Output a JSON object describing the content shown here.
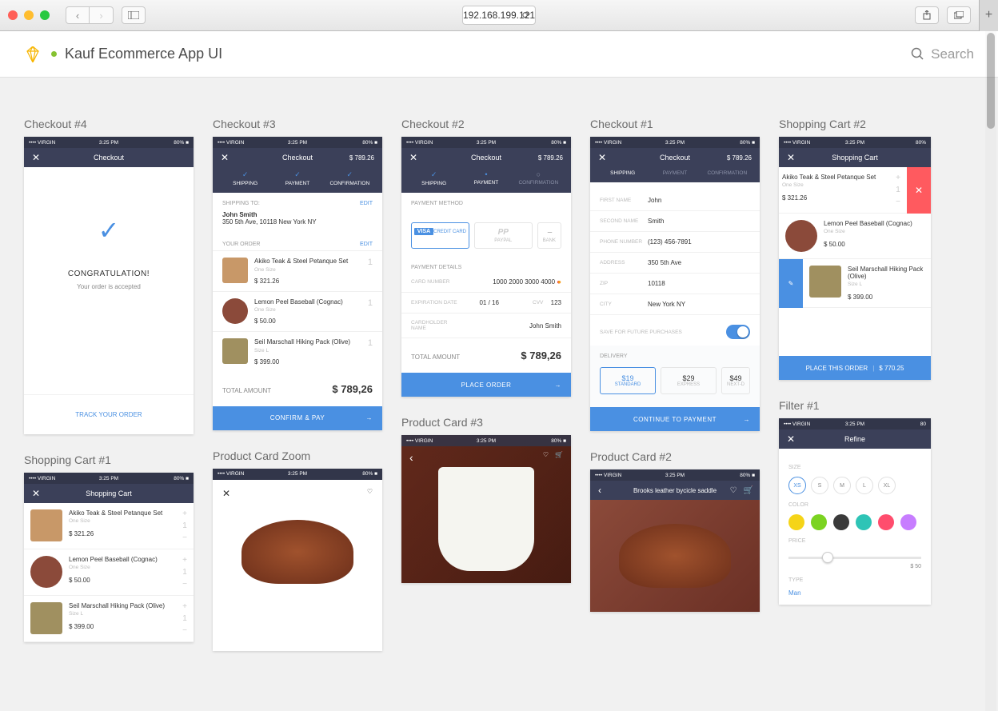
{
  "browser": {
    "url": "192.168.199.121"
  },
  "header": {
    "title": "Kauf Ecommerce App UI",
    "search_placeholder": "Search"
  },
  "status_bar": {
    "carrier": "•••• VIRGIN",
    "time": "3:25 PM",
    "battery": "80%"
  },
  "artboards": {
    "checkout4": {
      "label": "Checkout #4",
      "nav_title": "Checkout",
      "congrats": "CONGRATULATION!",
      "accepted": "Your order is accepted",
      "track": "TRACK YOUR ORDER"
    },
    "checkout3": {
      "label": "Checkout #3",
      "nav_title": "Checkout",
      "nav_price": "$ 789.26",
      "steps": [
        "SHIPPING",
        "PAYMENT",
        "CONFIRMATION"
      ],
      "shipping_to_label": "SHIPPING TO:",
      "edit": "EDIT",
      "ship_name": "John Smith",
      "ship_addr": "350 5th Ave, 10118 New York NY",
      "your_order_label": "YOUR ORDER",
      "items": [
        {
          "title": "Akiko Teak & Steel Petanque Set",
          "sub": "One Size",
          "price": "$ 321.26",
          "qty": "1"
        },
        {
          "title": "Lemon Peel Baseball (Cognac)",
          "sub": "One Size",
          "price": "$ 50.00",
          "qty": "1"
        },
        {
          "title": "Seil Marschall Hiking Pack (Olive)",
          "sub": "Size L",
          "price": "$ 399.00",
          "qty": "1"
        }
      ],
      "total_label": "TOTAL AMOUNT",
      "total": "$ 789,26",
      "cta": "CONFIRM & PAY"
    },
    "checkout2": {
      "label": "Checkout #2",
      "nav_title": "Checkout",
      "nav_price": "$ 789.26",
      "steps": [
        "SHIPPING",
        "PAYMENT",
        "CONFIRMATION"
      ],
      "pm_label": "PAYMENT METHOD",
      "pm_credit": "CREDIT CARD",
      "pm_paypal": "PAYPAL",
      "pm_bank": "BANK",
      "pd_label": "PAYMENT DETAILS",
      "card_number_label": "CARD NUMBER",
      "card_number": "1000   2000   3000   4000",
      "exp_label": "EXPIRATION DATE",
      "exp": "01  /  16",
      "cvv_label": "CVV",
      "cvv": "123",
      "holder_label": "CARDHOLDER NAME",
      "holder": "John Smith",
      "total_label": "TOTAL AMOUNT",
      "total": "$ 789,26",
      "cta": "PLACE ORDER"
    },
    "checkout1": {
      "label": "Checkout #1",
      "nav_title": "Checkout",
      "nav_price": "$ 789.26",
      "steps": [
        "SHIPPING",
        "PAYMENT",
        "CONFIRMATION"
      ],
      "fields": [
        {
          "label": "FIRST NAME",
          "val": "John"
        },
        {
          "label": "SECOND NAME",
          "val": "Smith"
        },
        {
          "label": "PHONE NUMBER",
          "val": "(123) 456-7891"
        },
        {
          "label": "ADDRESS",
          "val": "350 5th Ave"
        },
        {
          "label": "ZIP",
          "val": "10118"
        },
        {
          "label": "CITY",
          "val": "New York NY"
        }
      ],
      "save_label": "SAVE FOR FUTURE PURCHASES",
      "delivery_label": "DELIVERY",
      "delivery": [
        {
          "price": "$19",
          "lbl": "STANDARD"
        },
        {
          "price": "$29",
          "lbl": "EXPRESS"
        },
        {
          "price": "$49",
          "lbl": "NEXT-D"
        }
      ],
      "cta": "CONTINUE TO PAYMENT"
    },
    "cart2": {
      "label": "Shopping Cart #2",
      "nav_title": "Shopping Cart",
      "items": [
        {
          "title": "Akiko Teak & Steel Petanque Set",
          "sub": "One Size",
          "price": "$ 321.26"
        },
        {
          "title": "Lemon Peel Baseball (Cognac)",
          "sub": "One Size",
          "price": "$ 50.00"
        },
        {
          "title": "Seil Marschall Hiking Pack (Olive)",
          "sub": "Size L",
          "price": "$ 399.00"
        }
      ],
      "cta": "PLACE THIS ORDER",
      "cta_price": "$ 770.25"
    },
    "cart1": {
      "label": "Shopping Cart #1",
      "nav_title": "Shopping Cart",
      "items": [
        {
          "title": "Akiko Teak & Steel Petanque Set",
          "sub": "One Size",
          "price": "$ 321.26"
        },
        {
          "title": "Lemon Peel Baseball (Cognac)",
          "sub": "One Size",
          "price": "$ 50.00"
        },
        {
          "title": "Seil Marschall Hiking Pack (Olive)",
          "sub": "Size L",
          "price": "$ 399.00"
        }
      ]
    },
    "pcz": {
      "label": "Product Card Zoom"
    },
    "pc3": {
      "label": "Product Card #3"
    },
    "pc2": {
      "label": "Product Card #2",
      "nav_title": "Brooks leather bycicle saddle"
    },
    "filter1": {
      "label": "Filter #1",
      "nav_title": "Refine",
      "size_label": "SIZE",
      "sizes": [
        "XS",
        "S",
        "M",
        "L",
        "XL"
      ],
      "color_label": "COLOR",
      "colors": [
        "#f5d418",
        "#7bd321",
        "#3a3a3a",
        "#2ec4b6",
        "#ff4d6d",
        "#c77dff"
      ],
      "price_label": "PRICE",
      "price_max": "$ 50",
      "type_label": "TYPE",
      "type_val": "Man"
    }
  }
}
